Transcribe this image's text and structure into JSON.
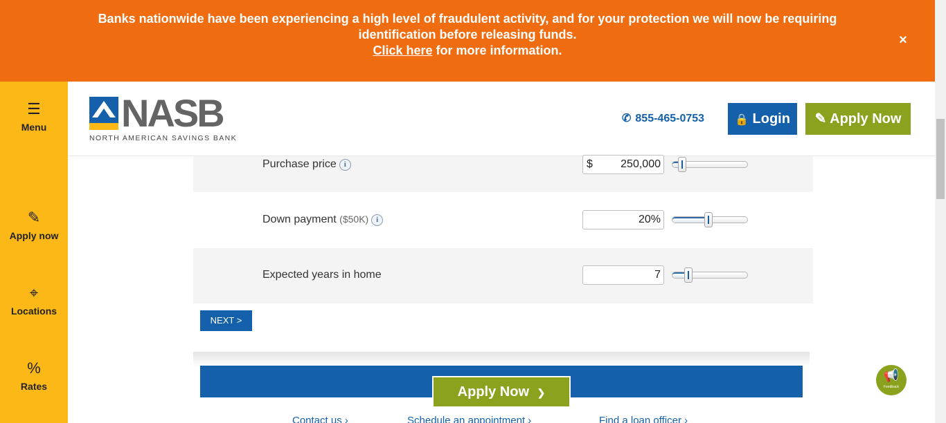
{
  "alert": {
    "line1": "Banks nationwide have been experiencing a high level of fraudulent activity, and for your protection we will now be requiring",
    "line2": "identification before releasing funds.",
    "link_text": "Click here",
    "line3_rest": " for more information.",
    "close_icon": "close-icon",
    "close_glyph": "×"
  },
  "sidenav": {
    "menu": {
      "label": "Menu",
      "icon": "hamburger-icon",
      "glyph": "☰"
    },
    "apply": {
      "label": "Apply now",
      "icon": "pencil-icon",
      "glyph": "✎"
    },
    "locations": {
      "label": "Locations",
      "icon": "map-pin-icon",
      "glyph": "⌖"
    },
    "rates": {
      "label": "Rates",
      "icon": "percent-icon",
      "glyph": "%"
    }
  },
  "header": {
    "logo_word": "NASB",
    "logo_sub": "NORTH AMERICAN SAVINGS BANK",
    "phone": "855-465-0753",
    "phone_glyph": "✆",
    "login_label": "Login",
    "login_glyph": "🔒",
    "apply_label": "Apply Now",
    "apply_glyph": "✎"
  },
  "calculator": {
    "purchase": {
      "label": "Purchase price",
      "prefix": "$",
      "value": "250,000",
      "slider_level": 0.08
    },
    "down": {
      "label": "Down payment",
      "note": "($50K)",
      "value": "20",
      "unit": "%",
      "slider_level": 0.48
    },
    "years": {
      "label": "Expected years in home",
      "value": "7",
      "slider_level": 0.18
    },
    "info_glyph": "i",
    "next_label": "NEXT >"
  },
  "cta": {
    "apply_label": "Apply Now",
    "apply_chevron": "❯"
  },
  "footer": {
    "contact": "Contact us ›",
    "schedule": "Schedule an appointment ›",
    "loan_officer": "Find a loan officer ›"
  },
  "feedback": {
    "label": "Feedback",
    "icon": "megaphone-icon",
    "glyph": "📢"
  },
  "colors": {
    "alert_bg": "#ef6c10",
    "nav_bg": "#fbb816",
    "brand_blue": "#1460aa",
    "brand_green": "#8aa21d"
  }
}
